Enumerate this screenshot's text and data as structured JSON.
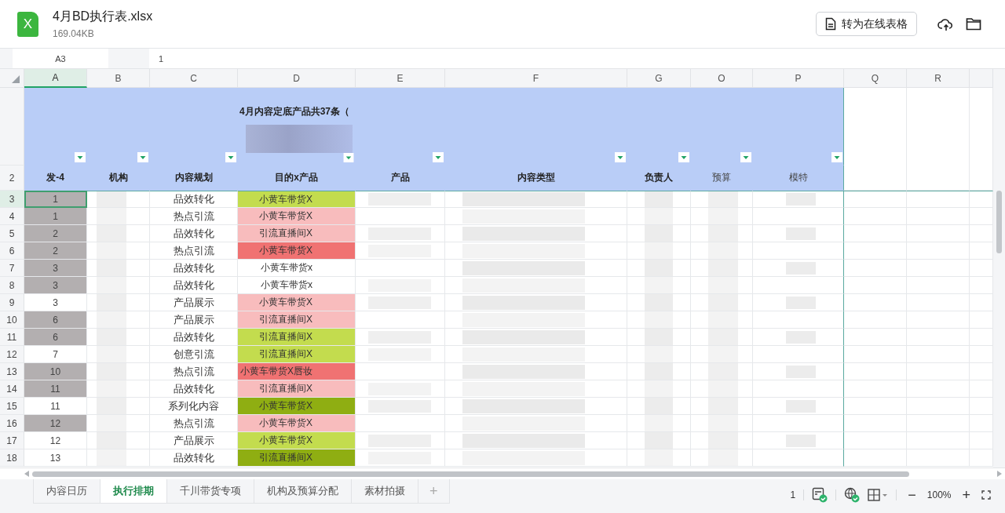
{
  "file": {
    "icon_letter": "X",
    "name": "4月BD执行表.xlsx",
    "size": "169.04KB"
  },
  "toolbar": {
    "convert_button": "转为在线表格"
  },
  "formula_bar": {
    "name_box": "A3",
    "value": "1"
  },
  "columns": [
    {
      "letter": "A",
      "selected": true
    },
    {
      "letter": "B",
      "selected": false
    },
    {
      "letter": "C",
      "selected": false
    },
    {
      "letter": "D",
      "selected": false
    },
    {
      "letter": "E",
      "selected": false
    },
    {
      "letter": "F",
      "selected": false
    },
    {
      "letter": "G",
      "selected": false
    },
    {
      "letter": "O",
      "selected": false
    },
    {
      "letter": "P",
      "selected": false
    },
    {
      "letter": "Q",
      "selected": false
    },
    {
      "letter": "R",
      "selected": false
    }
  ],
  "sheet_title": "4月内容定底产品共37条（",
  "header_row": {
    "number": "2",
    "cells": [
      {
        "text": "发-4",
        "bold": true
      },
      {
        "text": "机构",
        "bold": true
      },
      {
        "text": "内容规划",
        "bold": true
      },
      {
        "text": "目的x产品",
        "bold": true
      },
      {
        "text": "产品",
        "bold": true
      },
      {
        "text": "内容类型",
        "bold": true
      },
      {
        "text": "负责人",
        "bold": true
      },
      {
        "text": "预算",
        "bold": false
      },
      {
        "text": "模特",
        "bold": false
      }
    ]
  },
  "rows": [
    {
      "number": "3",
      "index_value": "1",
      "shaded": true,
      "selected": true,
      "plan": "品效转化",
      "target": "小黄车带货X",
      "color": "#c3dc4e"
    },
    {
      "number": "4",
      "index_value": "1",
      "shaded": true,
      "selected": false,
      "plan": "热点引流",
      "target": "小黄车带货X",
      "color": "#f8bcbd"
    },
    {
      "number": "5",
      "index_value": "2",
      "shaded": true,
      "selected": false,
      "plan": "品效转化",
      "target": "引流直播间X",
      "color": "#f8bcbd"
    },
    {
      "number": "6",
      "index_value": "2",
      "shaded": true,
      "selected": false,
      "plan": "热点引流",
      "target": "小黄车带货X",
      "color": "#f07272"
    },
    {
      "number": "7",
      "index_value": "3",
      "shaded": true,
      "selected": false,
      "plan": "品效转化",
      "target": "小黄车带货x",
      "color": "#ffffff"
    },
    {
      "number": "8",
      "index_value": "3",
      "shaded": true,
      "selected": false,
      "plan": "品效转化",
      "target": "小黄车带货x",
      "color": "#ffffff"
    },
    {
      "number": "9",
      "index_value": "3",
      "shaded": false,
      "selected": false,
      "plan": "产品展示",
      "target": "小黄车带货X",
      "color": "#f8bcbd"
    },
    {
      "number": "10",
      "index_value": "6",
      "shaded": true,
      "selected": false,
      "plan": "产品展示",
      "target": "引流直播间X",
      "color": "#f8bcbd"
    },
    {
      "number": "11",
      "index_value": "6",
      "shaded": true,
      "selected": false,
      "plan": "品效转化",
      "target": "引流直播间X",
      "color": "#c3dc4e"
    },
    {
      "number": "12",
      "index_value": "7",
      "shaded": false,
      "selected": false,
      "plan": "创意引流",
      "target": "引流直播间X",
      "color": "#c3dc4e"
    },
    {
      "number": "13",
      "index_value": "10",
      "shaded": true,
      "selected": false,
      "plan": "热点引流",
      "target": "小黄车带货X唇妆",
      "color": "#f07272"
    },
    {
      "number": "14",
      "index_value": "11",
      "shaded": true,
      "selected": false,
      "plan": "品效转化",
      "target": "引流直播间X",
      "color": "#f8bcbd"
    },
    {
      "number": "15",
      "index_value": "11",
      "shaded": false,
      "selected": false,
      "plan": "系列化内容",
      "target": "小黄车带货X",
      "color": "#8fae12"
    },
    {
      "number": "16",
      "index_value": "12",
      "shaded": true,
      "selected": false,
      "plan": "热点引流",
      "target": "小黄车带货X",
      "color": "#f8bcbd"
    },
    {
      "number": "17",
      "index_value": "12",
      "shaded": false,
      "selected": false,
      "plan": "产品展示",
      "target": "小黄车带货X",
      "color": "#c3dc4e"
    },
    {
      "number": "18",
      "index_value": "13",
      "shaded": false,
      "selected": false,
      "plan": "品效转化",
      "target": "引流直播间X",
      "color": "#8fae12"
    }
  ],
  "sheet_tabs": [
    {
      "label": "内容日历",
      "selected": false
    },
    {
      "label": "执行排期",
      "selected": true
    },
    {
      "label": "千川带货专项",
      "selected": false
    },
    {
      "label": "机构及预算分配",
      "selected": false
    },
    {
      "label": "素材拍摄",
      "selected": false
    }
  ],
  "add_sheet": "+",
  "status_bar": {
    "page": "1",
    "zoom_out": "−",
    "zoom": "100%",
    "zoom_in": "+"
  }
}
